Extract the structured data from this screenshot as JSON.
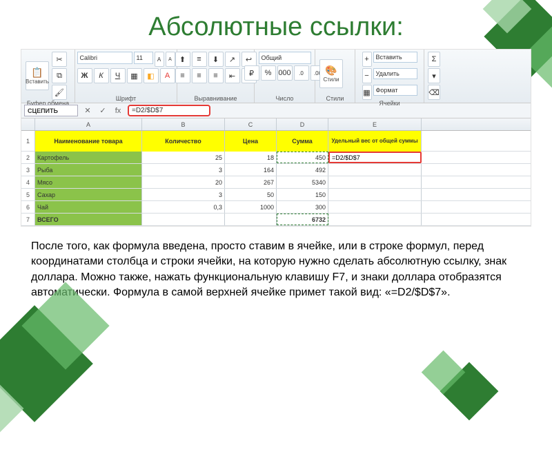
{
  "title": "Абсолютные ссылки:",
  "ribbon": {
    "paste": "Вставить",
    "groups": {
      "clipboard": "Буфер обмена",
      "font": "Шрифт",
      "alignment": "Выравнивание",
      "number": "Число",
      "styles": "Стили",
      "cells": "Ячейки"
    },
    "font_name": "Calibri",
    "font_size": "11",
    "number_fmt": "Общий",
    "bold": "Ж",
    "italic": "К",
    "underline": "Ч",
    "styles_label": "Стили",
    "insert": "Вставить",
    "delete": "Удалить",
    "format": "Формат",
    "sigma": "Σ"
  },
  "formula_bar": {
    "namebox": "СЦЕПИТЬ",
    "cancel": "✕",
    "accept": "✓",
    "fx": "fx",
    "value": "=D2/$D$7"
  },
  "columns": [
    "A",
    "B",
    "C",
    "D",
    "E"
  ],
  "headers": {
    "name": "Наименование товара",
    "qty": "Количество",
    "price": "Цена",
    "sum": "Сумма",
    "share": "Удельный вес от общей суммы"
  },
  "rows": [
    {
      "n": "2",
      "name": "Картофель",
      "qty": "25",
      "price": "18",
      "sum": "450",
      "share": "=D2/$D$7"
    },
    {
      "n": "3",
      "name": "Рыба",
      "qty": "3",
      "price": "164",
      "sum": "492",
      "share": ""
    },
    {
      "n": "4",
      "name": "Мясо",
      "qty": "20",
      "price": "267",
      "sum": "5340",
      "share": ""
    },
    {
      "n": "5",
      "name": "Сахар",
      "qty": "3",
      "price": "50",
      "sum": "150",
      "share": ""
    },
    {
      "n": "6",
      "name": "Чай",
      "qty": "0,3",
      "price": "1000",
      "sum": "300",
      "share": ""
    }
  ],
  "total": {
    "n": "7",
    "name": "ВСЕГО",
    "sum": "6732"
  },
  "body_text": "После того, как формула введена, просто ставим в ячейке, или в строке формул, перед координатами столбца и строки ячейки, на которую нужно сделать абсолютную ссылку, знак доллара. Можно также, нажать функциональную клавишу F7, и знаки доллара отобразятся автоматически. Формула в самой верхней ячейке примет такой вид: «=D2/$D$7»."
}
